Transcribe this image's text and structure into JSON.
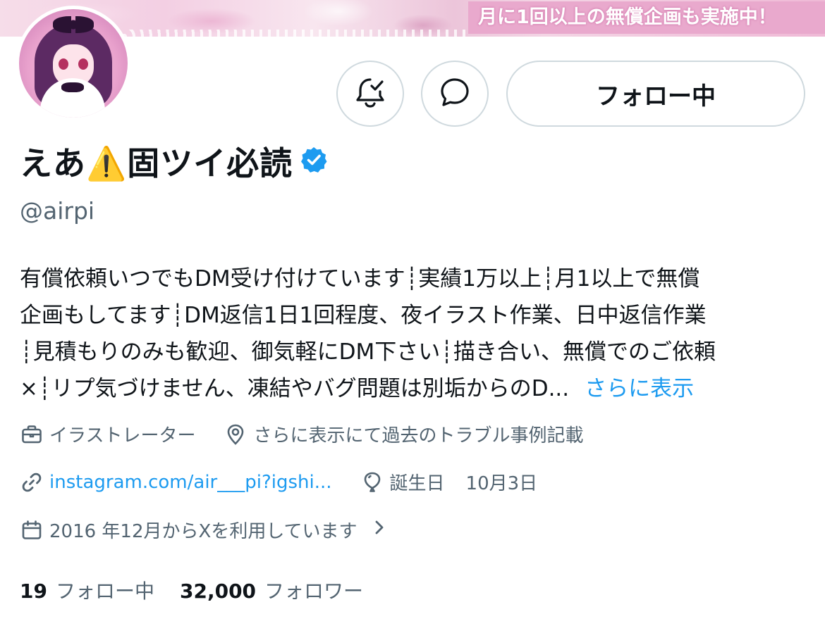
{
  "banner": {
    "text": "月に1回以上の無償企画も実施中！"
  },
  "profile": {
    "display_name": "えあ⚠️固ツイ必読",
    "handle": "@airpi",
    "verified": true
  },
  "actions": {
    "notify_icon": "bell-check-icon",
    "message_icon": "message-bubble-icon",
    "follow_label": "フォロー中"
  },
  "bio": {
    "lines": [
      "有償依頼いつでもDM受け付けています┊実績1万以上┊月1以上で無償",
      "企画もしてます┊DM返信1日1回程度、夜イラスト作業、日中返信作業",
      "┊見積もりのみも歓迎、御気軽にDM下さい┊描き合い、無償でのご依頼",
      "×┊リプ気づけません、凍結やバグ問題は別垢からのD..."
    ],
    "more_label": "さらに表示"
  },
  "meta": {
    "category": "イラストレーター",
    "location": "さらに表示にて過去のトラブル事例記載",
    "link": "instagram.com/air___pi?igshi...",
    "birthday_label": "誕生日",
    "birthday": "10月3日",
    "joined": "2016 年12月からXを利用しています"
  },
  "stats": {
    "following_count": "19",
    "following_label": "フォロー中",
    "followers_count": "32,000",
    "followers_label": "フォロワー"
  },
  "colors": {
    "accent": "#1d9bf0",
    "secondary_text": "#536471",
    "border": "#cfd9de",
    "verified": "#1d9bf0",
    "banner_pink": "#e9a9cd"
  }
}
